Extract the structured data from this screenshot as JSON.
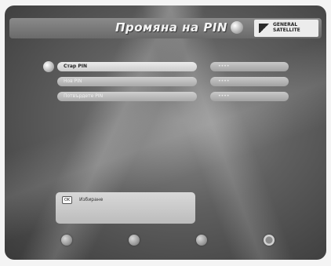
{
  "header": {
    "title": "Промяна на PIN",
    "logo_text": "GENERAL SATELLITE"
  },
  "form": {
    "fields": [
      {
        "label": "Стар PIN",
        "value": "••••"
      },
      {
        "label": "Нов PIN",
        "value": "••••"
      },
      {
        "label": "Потвърдете PIN",
        "value": "••••"
      }
    ]
  },
  "info": {
    "key": "OK",
    "text": "Избиране"
  },
  "footer": {
    "buttons": [
      "red-button-icon",
      "green-button-icon",
      "yellow-button-icon",
      "blue-button-icon"
    ]
  }
}
